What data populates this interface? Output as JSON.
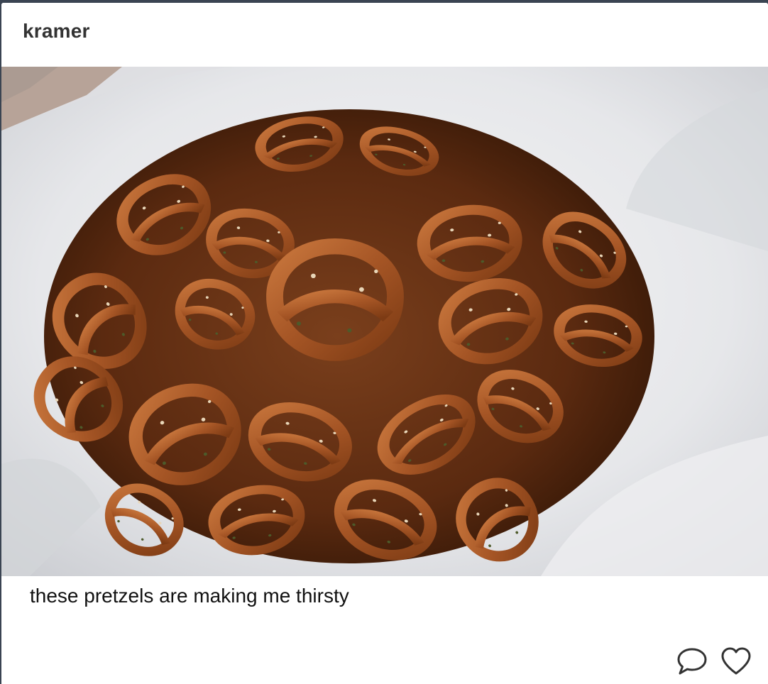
{
  "post": {
    "username": "kramer",
    "caption": "these pretzels are making me thirsty",
    "image_description": "bowl of pretzels",
    "actions": {
      "comment_icon": "speech-bubble-icon",
      "like_icon": "heart-icon"
    }
  },
  "colors": {
    "background": "#3a4452",
    "card": "#ffffff",
    "text": "#111111",
    "username": "#333333",
    "icon": "#333333"
  }
}
